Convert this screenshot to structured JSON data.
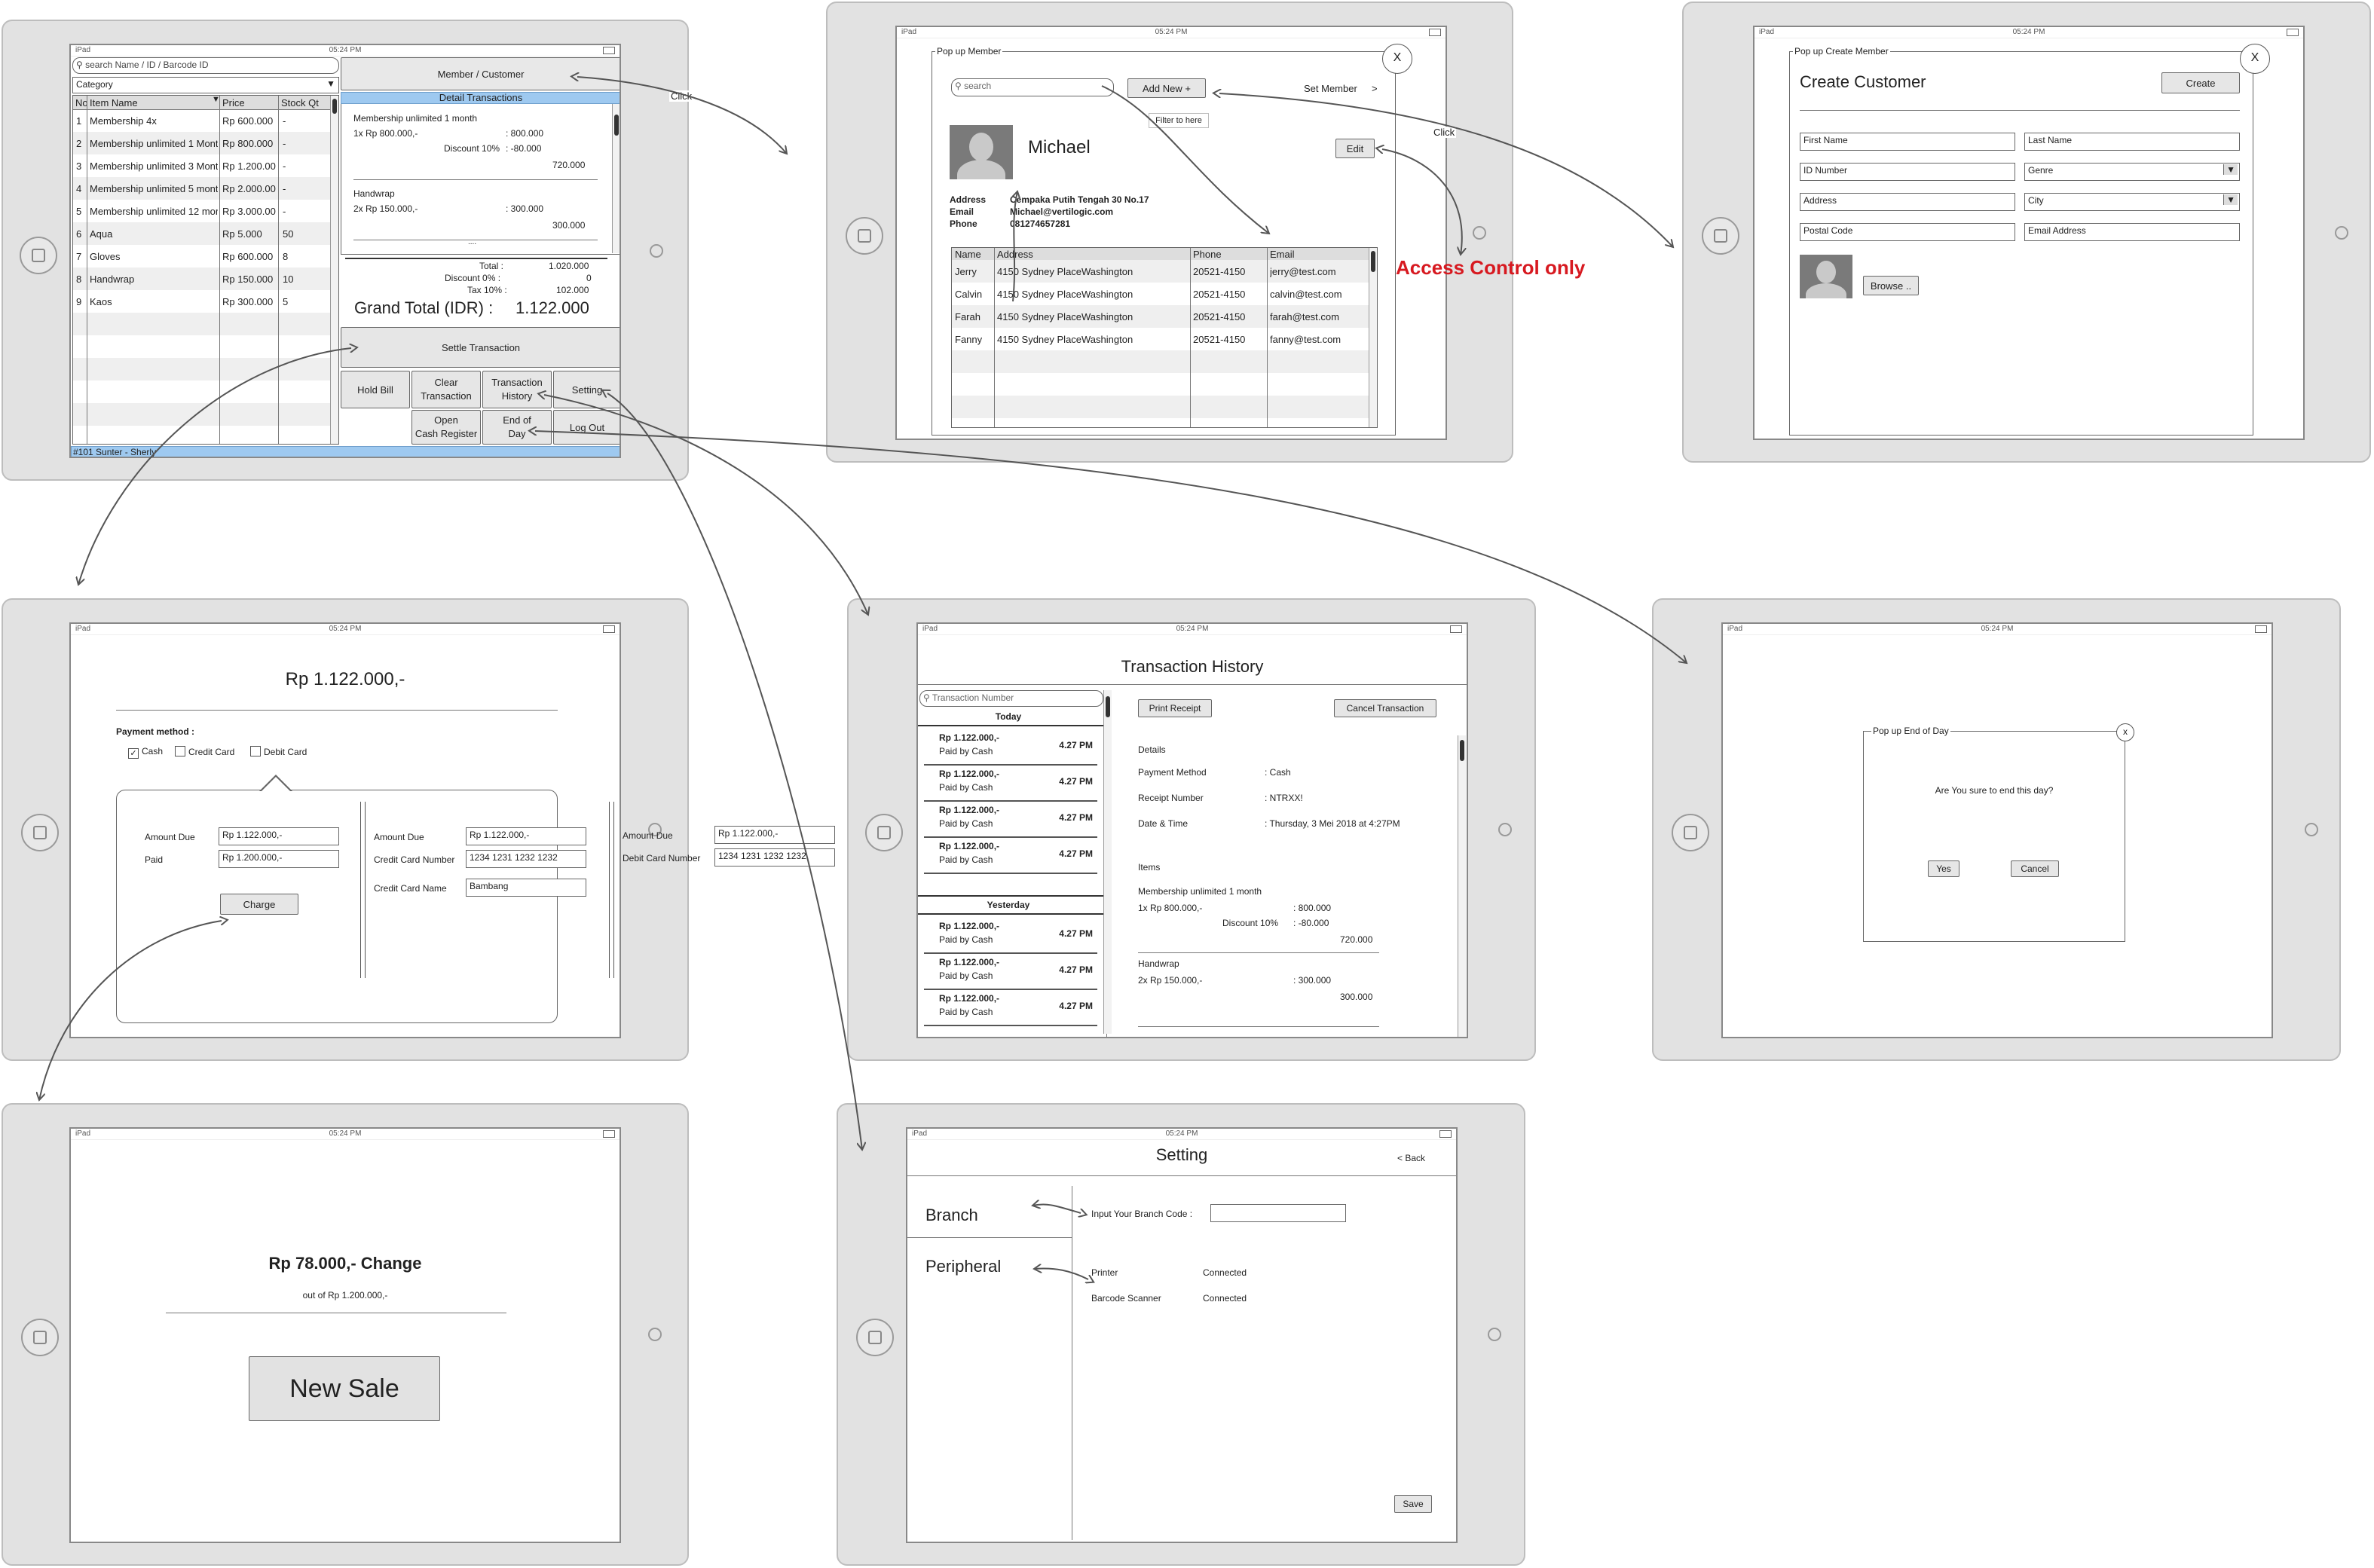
{
  "ipad": {
    "carrier": "iPad",
    "time": "05:24 PM"
  },
  "annotations": {
    "click1": "Click",
    "click2": "Click",
    "filter": "Filter to here",
    "access": "Access Control only",
    "access_color": "#d71920"
  },
  "pos": {
    "search_placeholder": "search Name / ID / Barcode ID",
    "category": "Category",
    "columns": [
      "No",
      "Item Name",
      "Price",
      "Stock Qt"
    ],
    "items": [
      {
        "no": "1",
        "name": "Membership 4x",
        "price": "Rp 600.000",
        "stock": "-"
      },
      {
        "no": "2",
        "name": "Membership unlimited 1 Mont",
        "price": "Rp 800.000",
        "stock": "-"
      },
      {
        "no": "3",
        "name": "Membership unlimited 3 Mont",
        "price": "Rp 1.200.00",
        "stock": "-"
      },
      {
        "no": "4",
        "name": "Membership unlimited 5 mont",
        "price": "Rp 2.000.00",
        "stock": "-"
      },
      {
        "no": "5",
        "name": "Membership unlimited 12 mor",
        "price": "Rp 3.000.00",
        "stock": "-"
      },
      {
        "no": "6",
        "name": "Aqua",
        "price": "Rp 5.000",
        "stock": "50"
      },
      {
        "no": "7",
        "name": "Gloves",
        "price": "Rp 600.000",
        "stock": "8"
      },
      {
        "no": "8",
        "name": "Handwrap",
        "price": "Rp 150.000",
        "stock": "10"
      },
      {
        "no": "9",
        "name": "Kaos",
        "price": "Rp 300.000",
        "stock": "5"
      }
    ],
    "member_button": "Member / Customer",
    "detail_header": "Detail Transactions",
    "detail": {
      "item1_name": "Membership unlimited 1 month",
      "item1_qty": "1x Rp 800.000,-",
      "item1_amount": ": 800.000",
      "item1_disc_label": "Discount 10%",
      "item1_disc": ": -80.000",
      "item1_total": "720.000",
      "item2_name": "Handwrap",
      "item2_qty": "2x Rp 150.000,-",
      "item2_amount": ": 300.000",
      "item2_total": "300.000",
      "dots": "....",
      "total_label": "Total :",
      "total_value": "1.020.000",
      "discount_label": "Discount 0% :",
      "discount_value": "0",
      "tax_label": "Tax 10% :",
      "tax_value": "102.000"
    },
    "grand_total_label": "Grand Total (IDR) :",
    "grand_total_value": "1.122.000",
    "settle": "Settle Transaction",
    "hold_bill": "Hold Bill",
    "clear1": "Clear",
    "clear2": "Transaction",
    "history1": "Transaction",
    "history2": "History",
    "setting": "Setting",
    "open1": "Open",
    "open2": "Cash Register",
    "eod1": "End of",
    "eod2": "Day",
    "logout": "Log Out",
    "footer": "#101 Sunter - Sherly"
  },
  "member": {
    "title": "Pop up Member",
    "close": "X",
    "search_placeholder": "search",
    "add_new": "Add New +",
    "set_member": "Set Member",
    "chevron": ">",
    "name": "Michael",
    "edit": "Edit",
    "address_label": "Address",
    "email_label": "Email",
    "phone_label": "Phone",
    "address": "Cempaka Putih Tengah 30 No.17",
    "email": "Michael@vertilogic.com",
    "phone": "081274657281",
    "columns": [
      "Name",
      "Address",
      "Phone",
      "Email"
    ],
    "rows": [
      {
        "name": "Jerry",
        "address": "4150 Sydney PlaceWashington",
        "phone": "20521-4150",
        "email": "jerry@test.com"
      },
      {
        "name": "Calvin",
        "address": "4150 Sydney PlaceWashington",
        "phone": "20521-4150",
        "email": "calvin@test.com"
      },
      {
        "name": "Farah",
        "address": "4150 Sydney PlaceWashington",
        "phone": "20521-4150",
        "email": "farah@test.com"
      },
      {
        "name": "Fanny",
        "address": "4150 Sydney PlaceWashington",
        "phone": "20521-4150",
        "email": "fanny@test.com"
      }
    ]
  },
  "create": {
    "title": "Pop up Create Member",
    "close": "X",
    "heading": "Create Customer",
    "create_btn": "Create",
    "first_name": "First Name",
    "last_name": "Last Name",
    "id_number": "ID Number",
    "genre": "Genre",
    "address": "Address",
    "city": "City",
    "postal": "Postal Code",
    "email": "Email Address",
    "browse": "Browse .."
  },
  "payment": {
    "amount": "Rp 1.122.000,-",
    "method_label": "Payment method :",
    "cash": "Cash",
    "credit": "Credit Card",
    "debit": "Debit Card",
    "cash_checked": "✓",
    "amount_due_label": "Amount Due",
    "amount_due": "Rp 1.122.000,-",
    "paid_label": "Paid",
    "paid": "Rp 1.200.000,-",
    "charge": "Charge",
    "cc_amount_due_label": "Amount Due",
    "cc_amount_due": "Rp 1.122.000,-",
    "cc_number_label": "Credit Card Number",
    "cc_number": "1234 1231 1232 1232",
    "cc_name_label": "Credit Card Name",
    "cc_name": "Bambang",
    "dc_amount_due_label": "Amount Due",
    "dc_amount_due": "Rp 1.122.000,-",
    "dc_number_label": "Debit Card Number",
    "dc_number": "1234 1231 1232 1232"
  },
  "history": {
    "title": "Transaction History",
    "search_placeholder": "Transaction Number",
    "today": "Today",
    "yesterday": "Yesterday",
    "entries_today": [
      {
        "amount": "Rp 1.122.000,-",
        "method": "Paid by Cash",
        "time": "4.27 PM"
      },
      {
        "amount": "Rp 1.122.000,-",
        "method": "Paid by Cash",
        "time": "4.27 PM"
      },
      {
        "amount": "Rp 1.122.000,-",
        "method": "Paid by Cash",
        "time": "4.27 PM"
      },
      {
        "amount": "Rp 1.122.000,-",
        "method": "Paid by Cash",
        "time": "4.27 PM"
      }
    ],
    "entries_yesterday": [
      {
        "amount": "Rp 1.122.000,-",
        "method": "Paid by Cash",
        "time": "4.27 PM"
      },
      {
        "amount": "Rp 1.122.000,-",
        "method": "Paid by Cash",
        "time": "4.27 PM"
      },
      {
        "amount": "Rp 1.122.000,-",
        "method": "Paid by Cash",
        "time": "4.27 PM"
      }
    ],
    "print": "Print Receipt",
    "cancel": "Cancel Transaction",
    "details": "Details",
    "pm_label": "Payment Method",
    "pm_value": ": Cash",
    "rn_label": "Receipt Number",
    "rn_value": ": NTRXX!",
    "dt_label": "Date & Time",
    "dt_value": ": Thursday, 3 Mei 2018 at 4:27PM",
    "items": "Items",
    "i1_name": "Membership unlimited 1 month",
    "i1_qty": "1x Rp 800.000,-",
    "i1_amount": ": 800.000",
    "i1_disc_label": "Discount 10%",
    "i1_disc": ": -80.000",
    "i1_total": "720.000",
    "i2_name": "Handwrap",
    "i2_qty": "2x Rp 150.000,-",
    "i2_amount": ": 300.000",
    "i2_total": "300.000"
  },
  "eod": {
    "title": "Pop up End of Day",
    "close": "x",
    "question": "Are You sure to end this day?",
    "yes": "Yes",
    "cancel": "Cancel"
  },
  "change": {
    "headline": "Rp 78.000,- Change",
    "sub": "out of Rp 1.200.000,-",
    "new_sale": "New Sale"
  },
  "setting": {
    "title": "Setting",
    "back": "Back",
    "back_chevron": "<",
    "branch": "Branch",
    "peripheral": "Peripheral",
    "branch_code_label": "Input Your Branch Code :",
    "printer": "Printer",
    "printer_status": "Connected",
    "scanner": "Barcode Scanner",
    "scanner_status": "Connected",
    "save": "Save"
  }
}
